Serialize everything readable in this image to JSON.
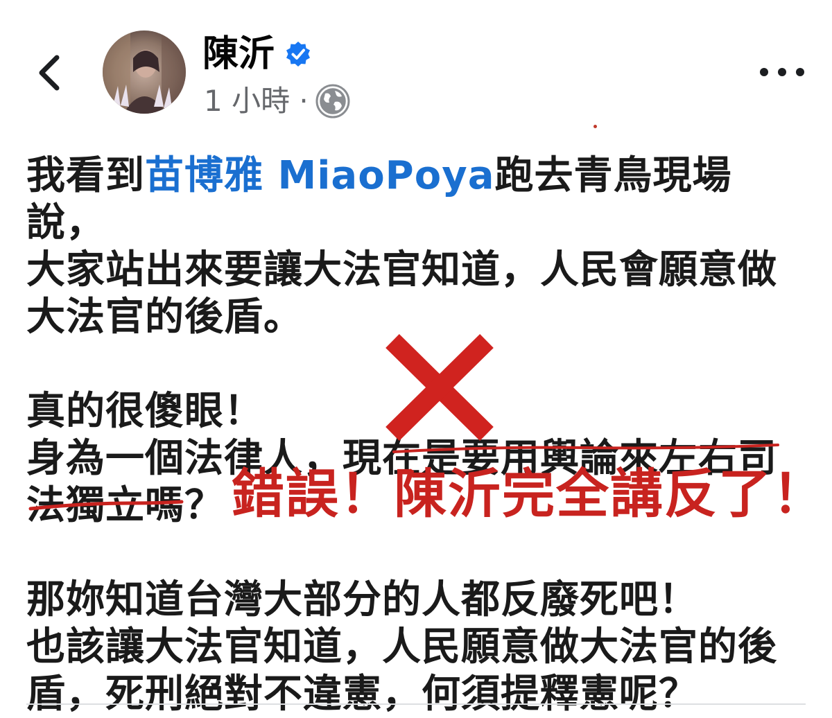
{
  "header": {
    "author_name": "陳沂",
    "time_label": "1 小時 ·",
    "verified_icon": "verified-check-icon",
    "globe_icon": "globe-icon",
    "colors": {
      "verified_blue": "#1877f2",
      "meta_gray": "#65676b"
    }
  },
  "post": {
    "line1_prefix": "我看到",
    "mention": "苗博雅 MiaoPoya",
    "line1_suffix": "跑去青鳥現場說，",
    "line2": "大家站出來要讓大法官知道，人民會願意做",
    "line3": "大法官的後盾。",
    "line4": "真的很傻眼！",
    "line5": "身為一個法律人，現在是要用輿論來左右司",
    "line6": "法獨立嗎？",
    "line7": "那妳知道台灣大部分的人都反廢死吧！",
    "line8": "也該讓大法官知道，人民願意做大法官的後",
    "line9": "盾，死刑絕對不違憲，何須提釋憲呢？",
    "colors": {
      "mention_blue": "#1a6fd0"
    }
  },
  "annotation": {
    "correction_text": "錯誤！陳沂完全講反了！",
    "x_mark_icon": "x-mark-icon",
    "colors": {
      "annotation_red": "#c8231f"
    }
  }
}
